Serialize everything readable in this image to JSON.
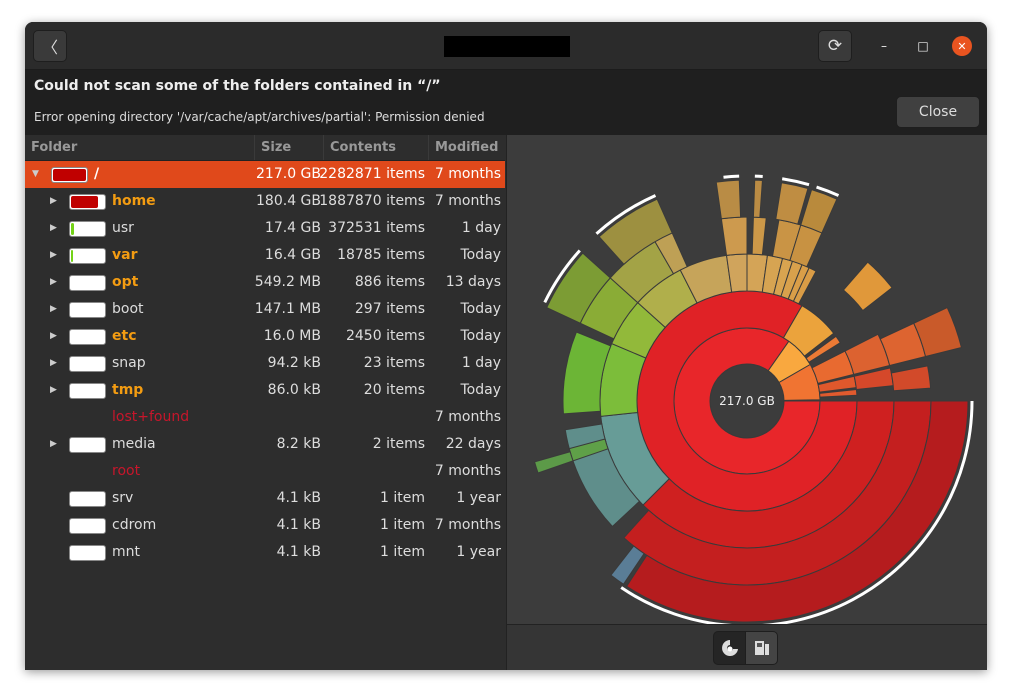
{
  "titlebar": {
    "back_icon": "chevron-left-icon",
    "refresh_icon": "refresh-icon",
    "minimize": "–",
    "maximize": "□",
    "close": "✕"
  },
  "infobar": {
    "title": "Could not scan some of the folders contained in “/”",
    "message": "Error opening directory '/var/cache/apt/archives/partial': Permission denied",
    "close_label": "Close"
  },
  "table": {
    "headers": {
      "folder": "Folder",
      "size": "Size",
      "contents": "Contents",
      "modified": "Modified"
    },
    "rows": [
      {
        "name": "/",
        "size": "217.0 GB",
        "contents": "2282871 items",
        "modified": "7 months",
        "expander": "expanded",
        "usage": 1.0,
        "style": "sel",
        "level": 0
      },
      {
        "name": "home",
        "size": "180.4 GB",
        "contents": "1887870 items",
        "modified": "7 months",
        "expander": "collapsed",
        "usage": 0.83,
        "style": "orange",
        "level": 1
      },
      {
        "name": "usr",
        "size": "17.4 GB",
        "contents": "372531 items",
        "modified": "1 day",
        "expander": "collapsed",
        "usage": 0.08,
        "style": "",
        "level": 1
      },
      {
        "name": "var",
        "size": "16.4 GB",
        "contents": "18785 items",
        "modified": "Today",
        "expander": "collapsed",
        "usage": 0.075,
        "style": "orange",
        "level": 1
      },
      {
        "name": "opt",
        "size": "549.2 MB",
        "contents": "886 items",
        "modified": "13 days",
        "expander": "collapsed",
        "usage": 0,
        "style": "orange",
        "level": 1
      },
      {
        "name": "boot",
        "size": "147.1 MB",
        "contents": "297 items",
        "modified": "Today",
        "expander": "collapsed",
        "usage": 0,
        "style": "",
        "level": 1
      },
      {
        "name": "etc",
        "size": "16.0 MB",
        "contents": "2450 items",
        "modified": "Today",
        "expander": "collapsed",
        "usage": 0,
        "style": "orange",
        "level": 1
      },
      {
        "name": "snap",
        "size": "94.2 kB",
        "contents": "23 items",
        "modified": "1 day",
        "expander": "collapsed",
        "usage": 0,
        "style": "",
        "level": 1
      },
      {
        "name": "tmp",
        "size": "86.0 kB",
        "contents": "20 items",
        "modified": "Today",
        "expander": "collapsed",
        "usage": 0,
        "style": "orange",
        "level": 1
      },
      {
        "name": "lost+found",
        "size": "",
        "contents": "",
        "modified": "7 months",
        "expander": "none",
        "usage": null,
        "style": "err",
        "level": 1
      },
      {
        "name": "media",
        "size": "8.2 kB",
        "contents": "2 items",
        "modified": "22 days",
        "expander": "collapsed",
        "usage": 0,
        "style": "",
        "level": 1
      },
      {
        "name": "root",
        "size": "",
        "contents": "",
        "modified": "7 months",
        "expander": "none",
        "usage": null,
        "style": "err",
        "level": 1
      },
      {
        "name": "srv",
        "size": "4.1 kB",
        "contents": "1 item",
        "modified": "1 year",
        "expander": "none",
        "usage": 0,
        "style": "",
        "level": 1
      },
      {
        "name": "cdrom",
        "size": "4.1 kB",
        "contents": "1 item",
        "modified": "7 months",
        "expander": "none",
        "usage": 0,
        "style": "",
        "level": 1
      },
      {
        "name": "mnt",
        "size": "4.1 kB",
        "contents": "1 item",
        "modified": "1 year",
        "expander": "none",
        "usage": 0,
        "style": "",
        "level": 1
      }
    ]
  },
  "chart": {
    "center_label": "217.0 GB"
  },
  "view_switcher": {
    "rings_icon": "rings-chart-icon",
    "treemap_icon": "treemap-chart-icon",
    "active": "rings"
  },
  "colors": {
    "accent": "#e0491b",
    "usage_red": "#c00000",
    "usage_green": "#73d216",
    "warning_orange": "#f39c12",
    "error_red": "#c7162b"
  }
}
